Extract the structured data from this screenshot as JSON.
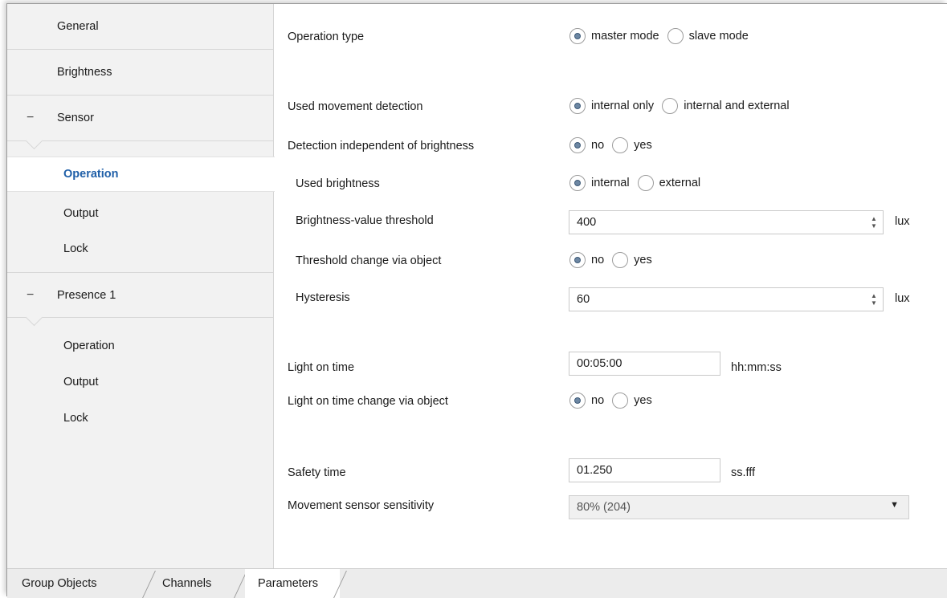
{
  "sidebar": {
    "general": "General",
    "brightness": "Brightness",
    "sensor_group": "Sensor",
    "sensor_items": [
      "Operation",
      "Output",
      "Lock"
    ],
    "presence_group": "Presence 1",
    "presence_items": [
      "Operation",
      "Output",
      "Lock"
    ],
    "collapse_symbol": "−"
  },
  "params": {
    "operation_type": {
      "label": "Operation type",
      "options": [
        "master mode",
        "slave mode"
      ],
      "selected": "master mode"
    },
    "movement_detection": {
      "label": "Used movement detection",
      "options": [
        "internal only",
        "internal and external"
      ],
      "selected": "internal only"
    },
    "detection_independent": {
      "label": "Detection independent of brightness",
      "options": [
        "no",
        "yes"
      ],
      "selected": "no"
    },
    "used_brightness": {
      "label": "Used brightness",
      "options": [
        "internal",
        "external"
      ],
      "selected": "internal"
    },
    "brightness_threshold": {
      "label": "Brightness-value threshold",
      "value": "400",
      "unit": "lux"
    },
    "threshold_change": {
      "label": "Threshold change via object",
      "options": [
        "no",
        "yes"
      ],
      "selected": "no"
    },
    "hysteresis": {
      "label": "Hysteresis",
      "value": "60",
      "unit": "lux"
    },
    "light_on_time": {
      "label": "Light on time",
      "value": "00:05:00",
      "unit": "hh:mm:ss"
    },
    "light_on_change": {
      "label": "Light on time change via object",
      "options": [
        "no",
        "yes"
      ],
      "selected": "no"
    },
    "safety_time": {
      "label": "Safety time",
      "value": "01.250",
      "unit": "ss.fff"
    },
    "sensitivity": {
      "label": "Movement sensor sensitivity",
      "value": "80% (204)"
    }
  },
  "tabs": [
    "Group Objects",
    "Channels",
    "Parameters"
  ],
  "active_tab": "Parameters",
  "icons": {
    "spinner_up": "▲",
    "spinner_down": "▼",
    "dropdown": "▼"
  },
  "colors": {
    "selected_nav_text": "#1f5fa8",
    "radio_dot": "#6d87a3",
    "sidebar_bg": "#f2f2f2"
  }
}
